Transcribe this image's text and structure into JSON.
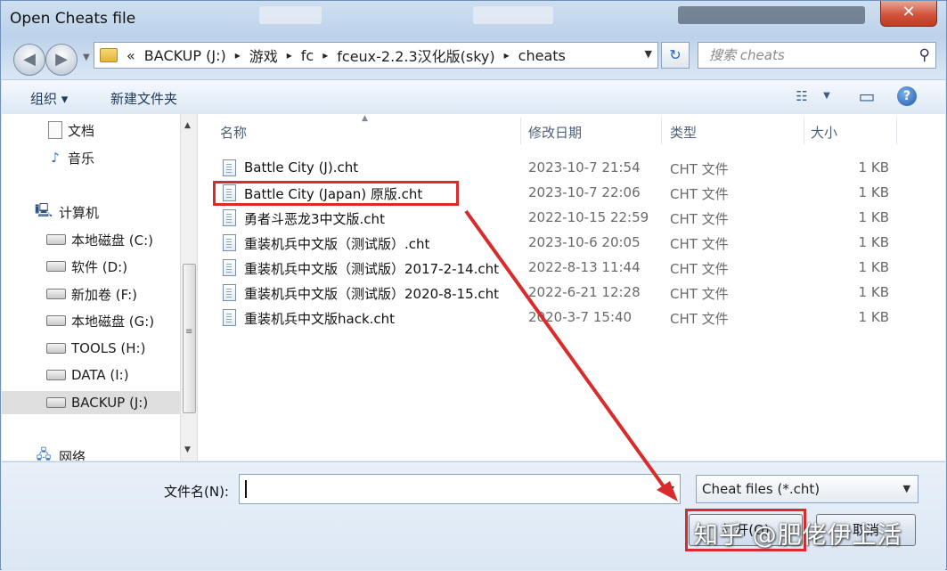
{
  "window": {
    "title": "Open Cheats file",
    "close_symbol": "✕"
  },
  "nav": {
    "back_symbol": "◀",
    "forward_symbol": "▶",
    "history_drop": "▼"
  },
  "address": {
    "overflow": "«",
    "crumbs": [
      "BACKUP (J:)",
      "游戏",
      "fc",
      "fceux-2.2.3汉化版(sky)",
      "cheats"
    ],
    "separator": "▸",
    "dropdown": "▼",
    "refresh_symbol": "↻"
  },
  "search": {
    "placeholder": "搜索 cheats",
    "icon": "⚲"
  },
  "toolbar": {
    "organize": "组织 ▾",
    "new_folder": "新建文件夹",
    "view_icon": "☷",
    "view_drop": "▼",
    "preview_icon": "▭",
    "help": "?"
  },
  "navpane": {
    "items": [
      {
        "label": "文档",
        "icon": "document-icon"
      },
      {
        "label": "音乐",
        "icon": "music-icon"
      },
      {
        "label": "计算机",
        "icon": "computer-icon"
      },
      {
        "label": "本地磁盘 (C:)",
        "icon": "drive-icon"
      },
      {
        "label": "软件 (D:)",
        "icon": "drive-icon"
      },
      {
        "label": "新加卷 (F:)",
        "icon": "drive-icon"
      },
      {
        "label": "本地磁盘 (G:)",
        "icon": "drive-icon"
      },
      {
        "label": "TOOLS (H:)",
        "icon": "drive-icon"
      },
      {
        "label": "DATA (I:)",
        "icon": "drive-icon"
      },
      {
        "label": "BACKUP (J:)",
        "icon": "drive-icon",
        "selected": true
      },
      {
        "label": "网络",
        "icon": "network-icon"
      }
    ],
    "scroll_up": "▲",
    "scroll_down": "▼",
    "scroll_grip": "≡"
  },
  "filelist": {
    "columns": {
      "name": "名称",
      "date": "修改日期",
      "type": "类型",
      "size": "大小"
    },
    "sort_indicator": "▲",
    "rows": [
      {
        "name": "Battle City (J).cht",
        "date": "2023-10-7 21:54",
        "type": "CHT 文件",
        "size": "1 KB"
      },
      {
        "name": "Battle City (Japan) 原版.cht",
        "date": "2023-10-7 22:06",
        "type": "CHT 文件",
        "size": "1 KB"
      },
      {
        "name": "勇者斗恶龙3中文版.cht",
        "date": "2022-10-15 22:59",
        "type": "CHT 文件",
        "size": "1 KB"
      },
      {
        "name": "重装机兵中文版（测试版）.cht",
        "date": "2023-10-6 20:05",
        "type": "CHT 文件",
        "size": "1 KB"
      },
      {
        "name": "重装机兵中文版（测试版）2017-2-14.cht",
        "date": "2022-8-13 11:44",
        "type": "CHT 文件",
        "size": "1 KB"
      },
      {
        "name": "重装机兵中文版（测试版）2020-8-15.cht",
        "date": "2022-6-21 12:28",
        "type": "CHT 文件",
        "size": "1 KB"
      },
      {
        "name": "重装机兵中文版hack.cht",
        "date": "2020-3-7 15:40",
        "type": "CHT 文件",
        "size": "1 KB"
      }
    ]
  },
  "bottom": {
    "filename_label": "文件名(N):",
    "filename_value": "",
    "filter_value": "Cheat files (*.cht)",
    "dropdown": "▼",
    "open_label": "打开(O)",
    "cancel_label": "取消"
  },
  "annotation": {
    "color": "#d92b2b",
    "watermark": "知乎 @肥佬伊上活"
  }
}
